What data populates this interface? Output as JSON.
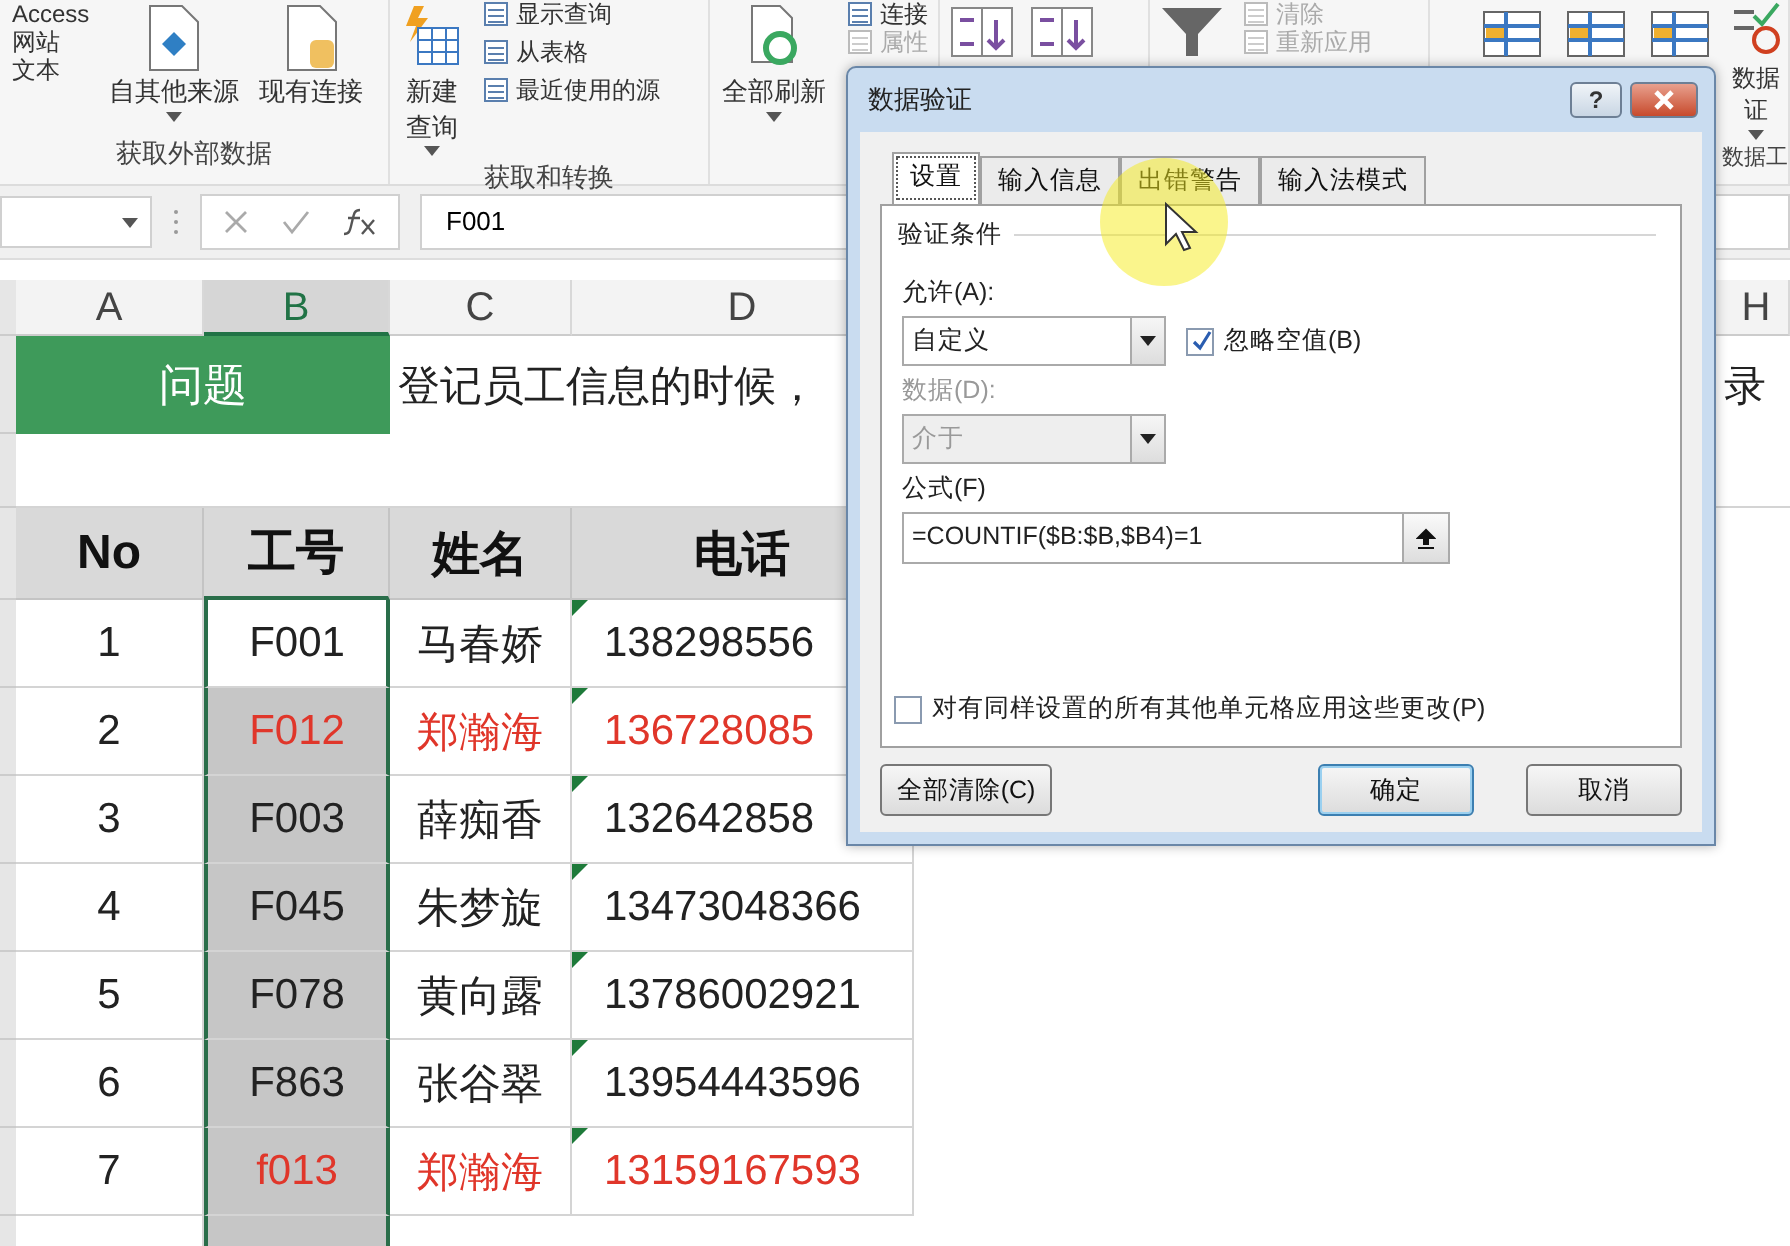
{
  "ribbon": {
    "groups": [
      {
        "label": "获取外部数据",
        "items": [
          {
            "kind": "stack",
            "entries": [
              {
                "label": "Access",
                "disabled": false
              },
              {
                "label": "网站",
                "disabled": false
              },
              {
                "label": "文本",
                "disabled": false
              }
            ]
          },
          {
            "kind": "large",
            "lines": [
              "自其他来源"
            ],
            "dropdown": true
          },
          {
            "kind": "large",
            "lines": [
              "现有连接"
            ],
            "dropdown": false
          }
        ]
      },
      {
        "label": "获取和转换",
        "items": [
          {
            "kind": "large",
            "lines": [
              "新建",
              "查询"
            ],
            "dropdown": true
          },
          {
            "kind": "stack",
            "entries": [
              {
                "label": "显示查询",
                "disabled": false
              },
              {
                "label": "从表格",
                "disabled": false
              },
              {
                "label": "最近使用的源",
                "disabled": false
              }
            ]
          }
        ]
      },
      {
        "items": [
          {
            "kind": "large",
            "lines": [
              "全部刷新"
            ],
            "dropdown": true
          },
          {
            "kind": "stack",
            "entries": [
              {
                "label": "连接",
                "disabled": false
              },
              {
                "label": "属性",
                "disabled": true
              }
            ]
          }
        ]
      },
      {
        "items": [
          {
            "kind": "icon"
          },
          {
            "kind": "icon"
          }
        ]
      },
      {
        "items": [
          {
            "kind": "icon"
          },
          {
            "kind": "stack",
            "entries": [
              {
                "label": "清除",
                "disabled": true
              },
              {
                "label": "重新应用",
                "disabled": true
              }
            ]
          }
        ]
      },
      {
        "label": "数据工",
        "items": [
          {
            "kind": "icon"
          },
          {
            "kind": "icon"
          },
          {
            "kind": "icon"
          },
          {
            "kind": "large",
            "lines": [
              "数据",
              "证"
            ],
            "dropdown": true
          }
        ]
      }
    ]
  },
  "formula_bar": {
    "formula": "F001"
  },
  "sheet": {
    "columns": [
      {
        "label": "A",
        "selected": false
      },
      {
        "label": "B",
        "selected": true
      },
      {
        "label": "C",
        "selected": false
      },
      {
        "label": "D",
        "selected": false
      },
      {
        "label": "H",
        "selected": false
      }
    ],
    "title_cell": "问题",
    "description": "登记员工信息的时候，",
    "description_tail": "录",
    "headers": [
      "No",
      "工号",
      "姓名",
      "电话"
    ],
    "rows": [
      {
        "no": "1",
        "id": "F001",
        "name": "马春娇",
        "phone": "138298556",
        "active": true,
        "highlighted": false,
        "text_flag": true
      },
      {
        "no": "2",
        "id": "F012",
        "name": "郑瀚海",
        "phone": "136728085",
        "active": false,
        "highlighted": true,
        "text_flag": true
      },
      {
        "no": "3",
        "id": "F003",
        "name": "薛痴香",
        "phone": "132642858",
        "active": false,
        "highlighted": false,
        "text_flag": true
      },
      {
        "no": "4",
        "id": "F045",
        "name": "朱梦旋",
        "phone": "13473048366",
        "active": false,
        "highlighted": false,
        "text_flag": true
      },
      {
        "no": "5",
        "id": "F078",
        "name": "黄向露",
        "phone": "13786002921",
        "active": false,
        "highlighted": false,
        "text_flag": true
      },
      {
        "no": "6",
        "id": "F863",
        "name": "张谷翠",
        "phone": "13954443596",
        "active": false,
        "highlighted": false,
        "text_flag": true
      },
      {
        "no": "7",
        "id": "f013",
        "name": "郑瀚海",
        "phone": "13159167593",
        "active": false,
        "highlighted": true,
        "text_flag": true
      }
    ]
  },
  "dialog": {
    "title": "数据验证",
    "help": "?",
    "tabs": [
      {
        "label": "设置",
        "selected": true
      },
      {
        "label": "输入信息",
        "selected": false
      },
      {
        "label": "出错警告",
        "selected": false
      },
      {
        "label": "输入法模式",
        "selected": false
      }
    ],
    "group_label": "验证条件",
    "allow_label": "允许(A):",
    "allow_value": "自定义",
    "ignore_blank": {
      "label": "忽略空值(B)",
      "checked": true
    },
    "data_label": "数据(D):",
    "data_value": "介于",
    "data_disabled": true,
    "formula_label": "公式(F)",
    "formula": "=COUNTIF($B:$B,$B4)=1",
    "apply_all": {
      "label": "对有同样设置的所有其他单元格应用这些更改(P)",
      "checked": false
    },
    "buttons": [
      {
        "label": "全部清除(C)",
        "default": false
      },
      {
        "label": "确定",
        "default": true
      },
      {
        "label": "取消",
        "default": false
      }
    ]
  }
}
